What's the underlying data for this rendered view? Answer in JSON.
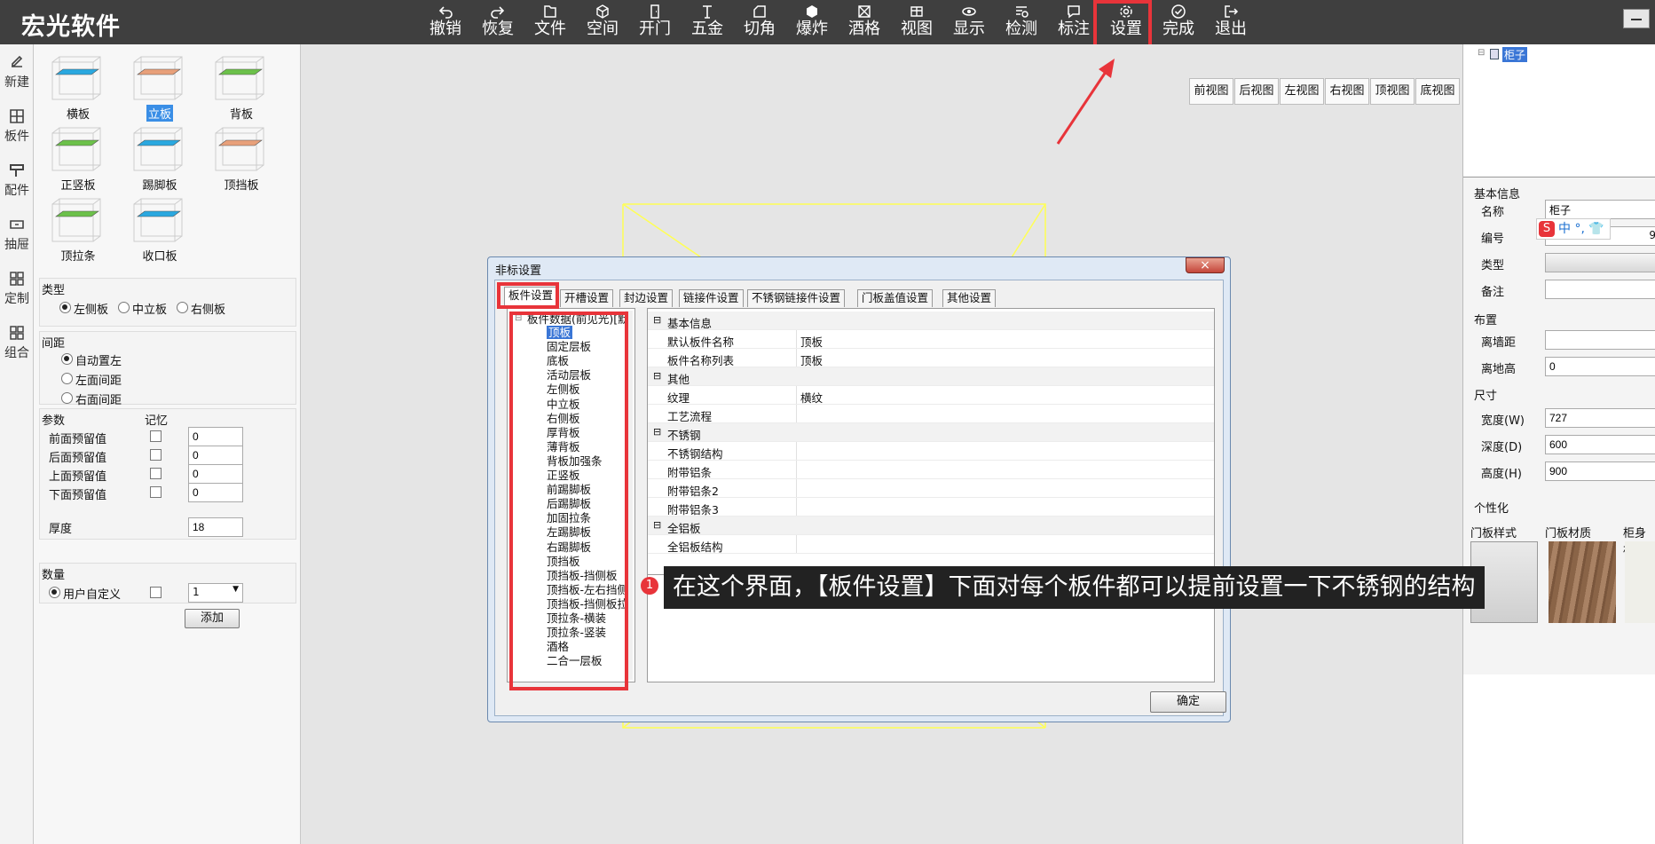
{
  "app": {
    "brand": "宏光软件"
  },
  "toolbar": [
    {
      "label": "撤销",
      "icon": "undo-icon"
    },
    {
      "label": "恢复",
      "icon": "redo-icon"
    },
    {
      "label": "文件",
      "icon": "file-icon"
    },
    {
      "label": "空间",
      "icon": "cube-icon"
    },
    {
      "label": "开门",
      "icon": "door-icon"
    },
    {
      "label": "五金",
      "icon": "hardware-icon"
    },
    {
      "label": "切角",
      "icon": "cut-corner-icon"
    },
    {
      "label": "爆炸",
      "icon": "explode-icon"
    },
    {
      "label": "酒格",
      "icon": "wine-rack-icon"
    },
    {
      "label": "视图",
      "icon": "view-icon"
    },
    {
      "label": "显示",
      "icon": "eye-icon"
    },
    {
      "label": "检测",
      "icon": "detect-icon"
    },
    {
      "label": "标注",
      "icon": "annotation-icon"
    },
    {
      "label": "设置",
      "icon": "gear-icon"
    },
    {
      "label": "完成",
      "icon": "check-circle-icon"
    },
    {
      "label": "退出",
      "icon": "exit-icon"
    }
  ],
  "leftnav": [
    {
      "label": "新建",
      "icon": "new-icon"
    },
    {
      "label": "板件",
      "icon": "board-icon"
    },
    {
      "label": "配件",
      "icon": "accessory-icon"
    },
    {
      "label": "抽屉",
      "icon": "drawer-icon"
    },
    {
      "label": "定制",
      "icon": "custom-icon"
    },
    {
      "label": "组合",
      "icon": "combine-icon"
    }
  ],
  "parts": [
    {
      "label": "横板",
      "color": "#2aa8e0"
    },
    {
      "label": "立板",
      "color": "#e8a07a",
      "selected": true
    },
    {
      "label": "背板",
      "color": "#6cc14a"
    },
    {
      "label": "正竖板",
      "color": "#6cc14a"
    },
    {
      "label": "踢脚板",
      "color": "#2aa8e0"
    },
    {
      "label": "顶挡板",
      "color": "#e8a07a"
    },
    {
      "label": "顶拉条",
      "color": "#6cc14a"
    },
    {
      "label": "收口板",
      "color": "#2aa8e0"
    }
  ],
  "type_group": {
    "title": "类型",
    "options": [
      "左侧板",
      "中立板",
      "右侧板"
    ],
    "selected": 0
  },
  "spacing_group": {
    "title": "间距",
    "options": [
      "自动置左",
      "左面间距",
      "右面间距"
    ],
    "selected": 0
  },
  "params_group": {
    "title": "参数",
    "memory": "记忆",
    "rows": [
      {
        "label": "前面预留值",
        "value": "0"
      },
      {
        "label": "后面预留值",
        "value": "0"
      },
      {
        "label": "上面预留值",
        "value": "0"
      },
      {
        "label": "下面预留值",
        "value": "0"
      }
    ],
    "thickness_label": "厚度",
    "thickness": "18"
  },
  "qty_group": {
    "title": "数量",
    "option": "用户自定义",
    "value": "1"
  },
  "add_button": "添加",
  "views": [
    "前视图",
    "后视图",
    "左视图",
    "右视图",
    "顶视图",
    "底视图"
  ],
  "right": {
    "tree_root": "柜子",
    "basic_title": "基本信息",
    "name_label": "名称",
    "name_value": "柜子",
    "code_label": "编号",
    "code_value": "9",
    "type_label": "类型",
    "note_label": "备注",
    "layout_title": "布置",
    "wall_label": "离墙距",
    "floor_label": "离地高",
    "floor_value": "0",
    "size_title": "尺寸",
    "width_label": "宽度(W)",
    "width_value": "727",
    "depth_label": "深度(D)",
    "depth_value": "600",
    "height_label": "高度(H)",
    "height_value": "900",
    "personal_title": "个性化",
    "door_style": "门板样式",
    "door_material": "门板材质",
    "body_material": "柜身材质",
    "ime": "中 °, 👕"
  },
  "dialog": {
    "title": "非标设置",
    "close": "×",
    "tabs": [
      "板件设置",
      "开槽设置",
      "封边设置",
      "链接件设置",
      "不锈钢链接件设置",
      "门板盖值设置",
      "其他设置"
    ],
    "tree_root": "板件数据(前见光)[默",
    "tree_items": [
      "顶板",
      "固定层板",
      "底板",
      "活动层板",
      "左侧板",
      "中立板",
      "右侧板",
      "厚背板",
      "薄背板",
      "背板加强条",
      "正竖板",
      "前踢脚板",
      "后踢脚板",
      "加固拉条",
      "左踢脚板",
      "右踢脚板",
      "顶挡板",
      "顶挡板-挡侧板",
      "顶挡板-左右挡侧",
      "顶挡板-挡侧板拉",
      "顶拉条-横装",
      "顶拉条-竖装",
      "酒格",
      "二合一层板"
    ],
    "props": [
      {
        "cat": "基本信息"
      },
      {
        "k": "默认板件名称",
        "v": "顶板"
      },
      {
        "k": "板件名称列表",
        "v": "顶板"
      },
      {
        "cat": "其他"
      },
      {
        "k": "纹理",
        "v": "横纹"
      },
      {
        "k": "工艺流程",
        "v": ""
      },
      {
        "cat": "不锈钢"
      },
      {
        "k": "不锈钢结构",
        "v": ""
      },
      {
        "k": "附带铝条",
        "v": ""
      },
      {
        "k": "附带铝条2",
        "v": ""
      },
      {
        "k": "附带铝条3",
        "v": ""
      },
      {
        "cat": "全铝板"
      },
      {
        "k": "全铝板结构",
        "v": ""
      }
    ],
    "ok": "确定"
  },
  "annotation": {
    "number": "1",
    "text": "在这个界面，【板件设置】下面对每个板件都可以提前设置一下不锈钢的结构"
  }
}
